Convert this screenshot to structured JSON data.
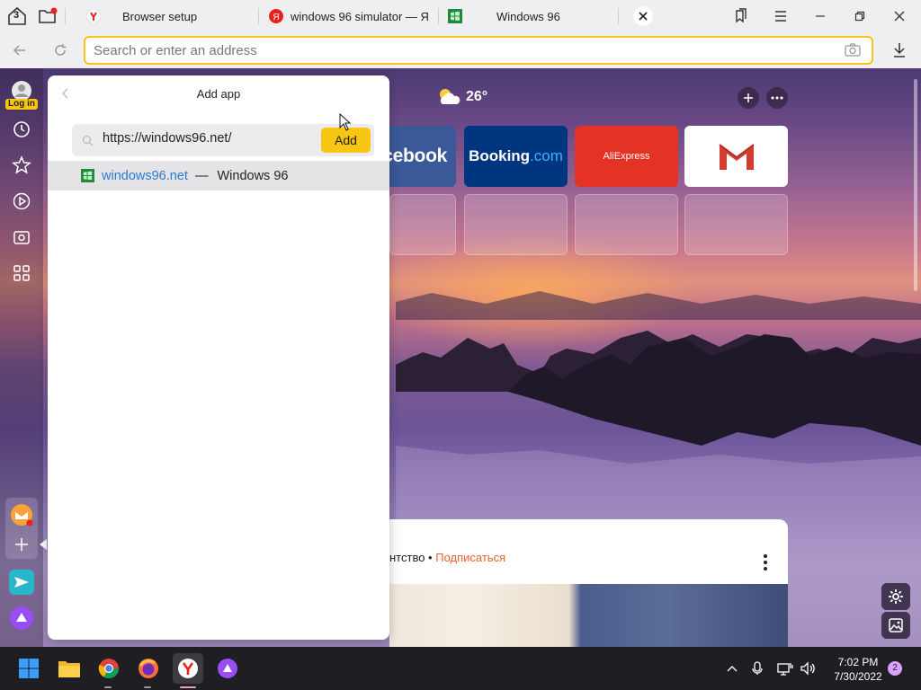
{
  "tabbar": {
    "tab_count": "3",
    "tabs": [
      {
        "title": "Browser setup"
      },
      {
        "title": "windows 96 simulator — Я"
      },
      {
        "title": "Windows 96"
      }
    ]
  },
  "address_bar": {
    "placeholder": "Search or enter an address"
  },
  "sidebar": {
    "login_label": "Log in"
  },
  "newtab": {
    "weather": {
      "temp": "26°"
    },
    "tiles": [
      {
        "label": "cebook",
        "color": "#3b5998"
      },
      {
        "label": "Booking",
        "label2": ".com",
        "color": "#003580"
      },
      {
        "label": "AliExpress",
        "color": "#e43225"
      },
      {
        "label": "Gmail",
        "color": "#ffffff"
      }
    ],
    "feed": {
      "text": "нтство • ",
      "subscribe": "Подписаться"
    }
  },
  "panel": {
    "title": "Add app",
    "url_value": "https://windows96.net/",
    "add_label": "Add",
    "suggestion": {
      "domain": "windows96.net",
      "sep": " — ",
      "title": "Windows 96"
    }
  },
  "taskbar": {
    "time": "7:02 PM",
    "date": "7/30/2022",
    "notifications": "2"
  },
  "colors": {
    "accent": "#f8c512",
    "omnibox_border": "#f5c518",
    "link": "#2a7ad1",
    "subscribe": "#e8612c"
  }
}
